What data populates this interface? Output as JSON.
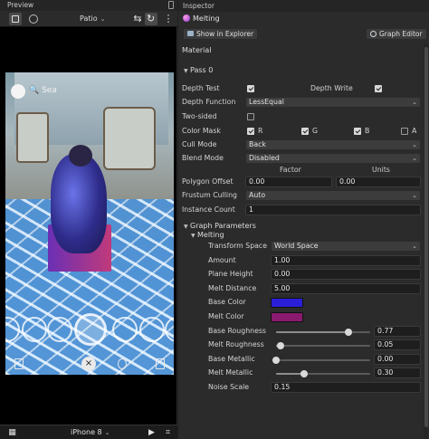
{
  "preview": {
    "title": "Preview",
    "scene": "Patio",
    "device": "iPhone 8",
    "overlay_search": "Sea"
  },
  "inspector": {
    "title": "Inspector",
    "object_name": "Melting",
    "show_in_explorer": "Show in Explorer",
    "graph_editor": "Graph Editor",
    "section_material": "Material",
    "pass_label": "Pass 0",
    "depth_test": {
      "label": "Depth Test",
      "checked": true
    },
    "depth_write": {
      "label": "Depth Write",
      "checked": true
    },
    "depth_function": {
      "label": "Depth Function",
      "value": "LessEqual"
    },
    "two_sided": {
      "label": "Two-sided",
      "checked": false
    },
    "color_mask": {
      "label": "Color Mask",
      "r": "R",
      "g": "G",
      "b": "B",
      "a": "A",
      "r_on": true,
      "g_on": true,
      "b_on": true,
      "a_on": false
    },
    "cull_mode": {
      "label": "Cull Mode",
      "value": "Back"
    },
    "blend_mode": {
      "label": "Blend Mode",
      "value": "Disabled"
    },
    "offset_headers": {
      "factor": "Factor",
      "units": "Units"
    },
    "polygon_offset": {
      "label": "Polygon Offset",
      "factor": "0.00",
      "units": "0.00"
    },
    "frustum_culling": {
      "label": "Frustum Culling",
      "value": "Auto"
    },
    "instance_count": {
      "label": "Instance Count",
      "value": "1"
    },
    "graph_parameters": "Graph Parameters",
    "graph_name": "Melting",
    "params": {
      "transform_space": {
        "label": "Transform Space",
        "value": "World Space"
      },
      "amount": {
        "label": "Amount",
        "value": "1.00"
      },
      "plane_height": {
        "label": "Plane Height",
        "value": "0.00"
      },
      "melt_distance": {
        "label": "Melt Distance",
        "value": "5.00"
      },
      "base_color": {
        "label": "Base Color",
        "color": "#2a1fd6"
      },
      "melt_color": {
        "label": "Melt Color",
        "color": "#8a1a6f"
      },
      "base_roughness": {
        "label": "Base Roughness",
        "value": "0.77",
        "fraction": 0.77
      },
      "melt_roughness": {
        "label": "Melt Roughness",
        "value": "0.05",
        "fraction": 0.05
      },
      "base_metallic": {
        "label": "Base Metallic",
        "value": "0.00",
        "fraction": 0.0
      },
      "melt_metallic": {
        "label": "Melt Metallic",
        "value": "0.30",
        "fraction": 0.3
      },
      "noise_scale": {
        "label": "Noise Scale",
        "value": "0.15"
      }
    }
  }
}
